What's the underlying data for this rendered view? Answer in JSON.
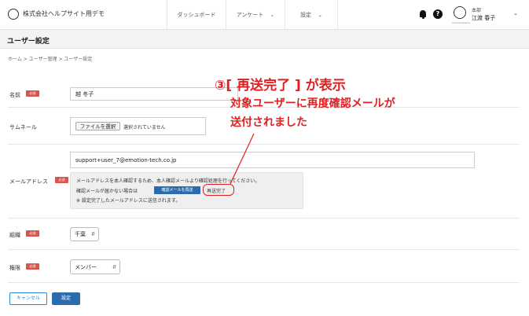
{
  "header": {
    "company": "株式会社ヘルプサイト用デモ",
    "nav": [
      {
        "label": "ダッシュボード"
      },
      {
        "label": "アンケート",
        "chevron": "chevron-down-icon"
      },
      {
        "label": "設定",
        "chevron": "chevron-down-icon"
      }
    ],
    "avatar_sub": "CompanyName",
    "user_dept": "本部",
    "user_name": "江渡 春子"
  },
  "page": {
    "title": "ユーザー設定",
    "breadcrumb": "ホーム > ユーザー管理 > ユーザー設定"
  },
  "form": {
    "required_badge": "必須",
    "name": {
      "label": "名前",
      "value": "越 冬子"
    },
    "thumbnail": {
      "label": "サムネール",
      "file_button": "ファイルを選択",
      "file_status": "選択されていません"
    },
    "email": {
      "label": "メールアドレス",
      "value": "support+user_7@emotion-tech.co.jp",
      "notice_line1": "メールアドレスを本人確認するため、本人確認メールより確認処理を行ってください。",
      "notice_line2": "確認メールが届かない場合は",
      "resend_button": "確認メールを再送",
      "resend_done": "再送完了",
      "notice_line3": "※ 設定完了したメールアドレスに送信されます。"
    },
    "organization": {
      "label": "組織",
      "value": "千葉"
    },
    "role": {
      "label": "権限",
      "value": "メンバー"
    },
    "cancel_button": "キャンセル",
    "save_button": "設定"
  },
  "annotation": {
    "title": "③[ 再送完了 ] が表示",
    "line1": "対象ユーザーに再度確認メールが",
    "line2": "送付されました",
    "color": "#e02020"
  },
  "colors": {
    "primary": "#2b6cb0",
    "required": "#d9534f",
    "annotation": "#e02020"
  }
}
